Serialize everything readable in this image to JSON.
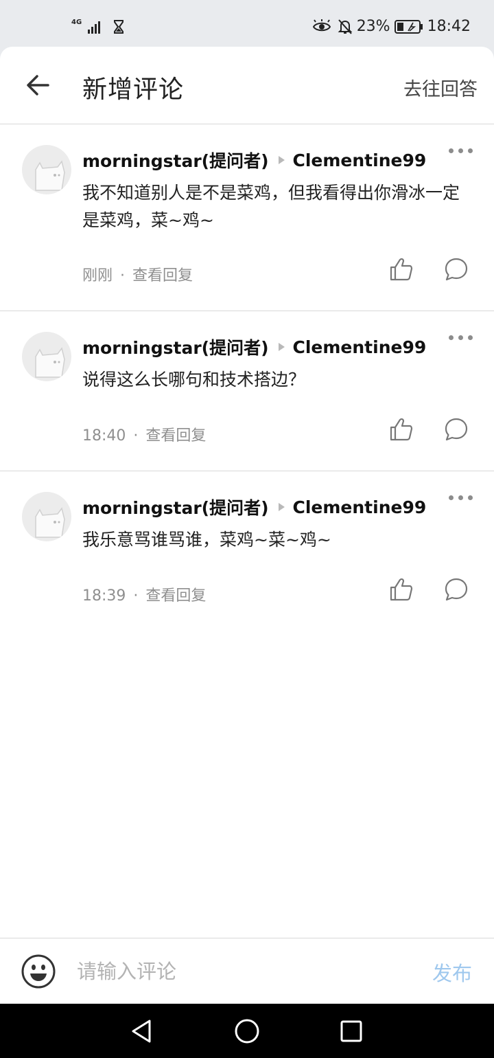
{
  "status_bar": {
    "network": "4G",
    "battery_percent": "23%",
    "time": "18:42",
    "icons": [
      "signal-icon",
      "hourglass-icon",
      "eye-icon",
      "bell-off-icon",
      "battery-icon"
    ]
  },
  "header": {
    "title": "新增评论",
    "goto_answer": "去往回答"
  },
  "comments": [
    {
      "author": "morningstar(提问者)",
      "reply_to": "Clementine99",
      "text": "我不知道别人是不是菜鸡，但我看得出你滑冰一定是菜鸡，菜~鸡~",
      "time": "刚刚",
      "separator": "·",
      "view_replies": "查看回复"
    },
    {
      "author": "morningstar(提问者)",
      "reply_to": "Clementine99",
      "text": "说得这么长哪句和技术搭边？",
      "time": "18:40",
      "separator": "·",
      "view_replies": "查看回复"
    },
    {
      "author": "morningstar(提问者)",
      "reply_to": "Clementine99",
      "text": "我乐意骂谁骂谁，菜鸡~菜~鸡~",
      "time": "18:39",
      "separator": "·",
      "view_replies": "查看回复"
    }
  ],
  "input": {
    "placeholder": "请输入评论",
    "value": "",
    "publish_label": "发布"
  },
  "colors": {
    "publish_disabled": "#9fc8ee",
    "divider": "#d8d8d8",
    "secondary_text": "#8f8f8f"
  }
}
